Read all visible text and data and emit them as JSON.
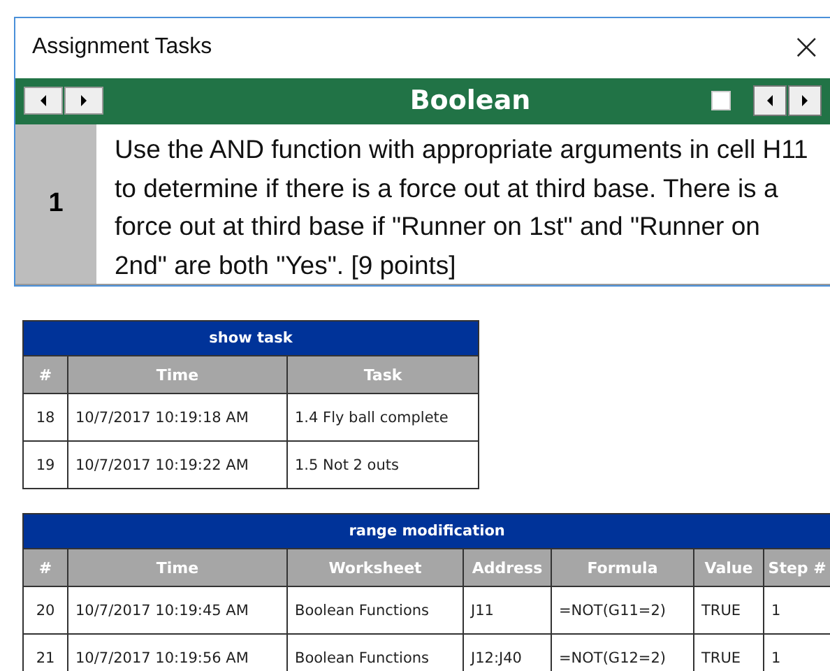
{
  "window": {
    "title": "Assignment Tasks",
    "close": "×"
  },
  "task_bar": {
    "title": "Boolean",
    "checked": false
  },
  "task": {
    "number": "1",
    "text": "Use the AND function with appropriate arguments in cell H11 to determine if there is a force out at third base. There is a force out at third base if \"Runner on 1st\" and \"Runner on 2nd\" are both \"Yes\". [9 points]"
  },
  "tables": [
    {
      "title": "show task",
      "columns": [
        "#",
        "Time",
        "Task"
      ],
      "rows": [
        [
          "18",
          "10/7/2017 10:19:18 AM",
          "1.4 Fly ball complete"
        ],
        [
          "19",
          "10/7/2017 10:19:22 AM",
          "1.5 Not 2 outs"
        ]
      ]
    },
    {
      "title": "range modification",
      "columns": [
        "#",
        "Time",
        "Worksheet",
        "Address",
        "Formula",
        "Value",
        "Step #"
      ],
      "rows": [
        [
          "20",
          "10/7/2017 10:19:45 AM",
          "Boolean Functions",
          "J11",
          "=NOT(G11=2)",
          "TRUE",
          "1"
        ],
        [
          "21",
          "10/7/2017 10:19:56 AM",
          "Boolean Functions",
          "J12:J40",
          "=NOT(G12=2)",
          "TRUE",
          "1"
        ]
      ]
    }
  ]
}
